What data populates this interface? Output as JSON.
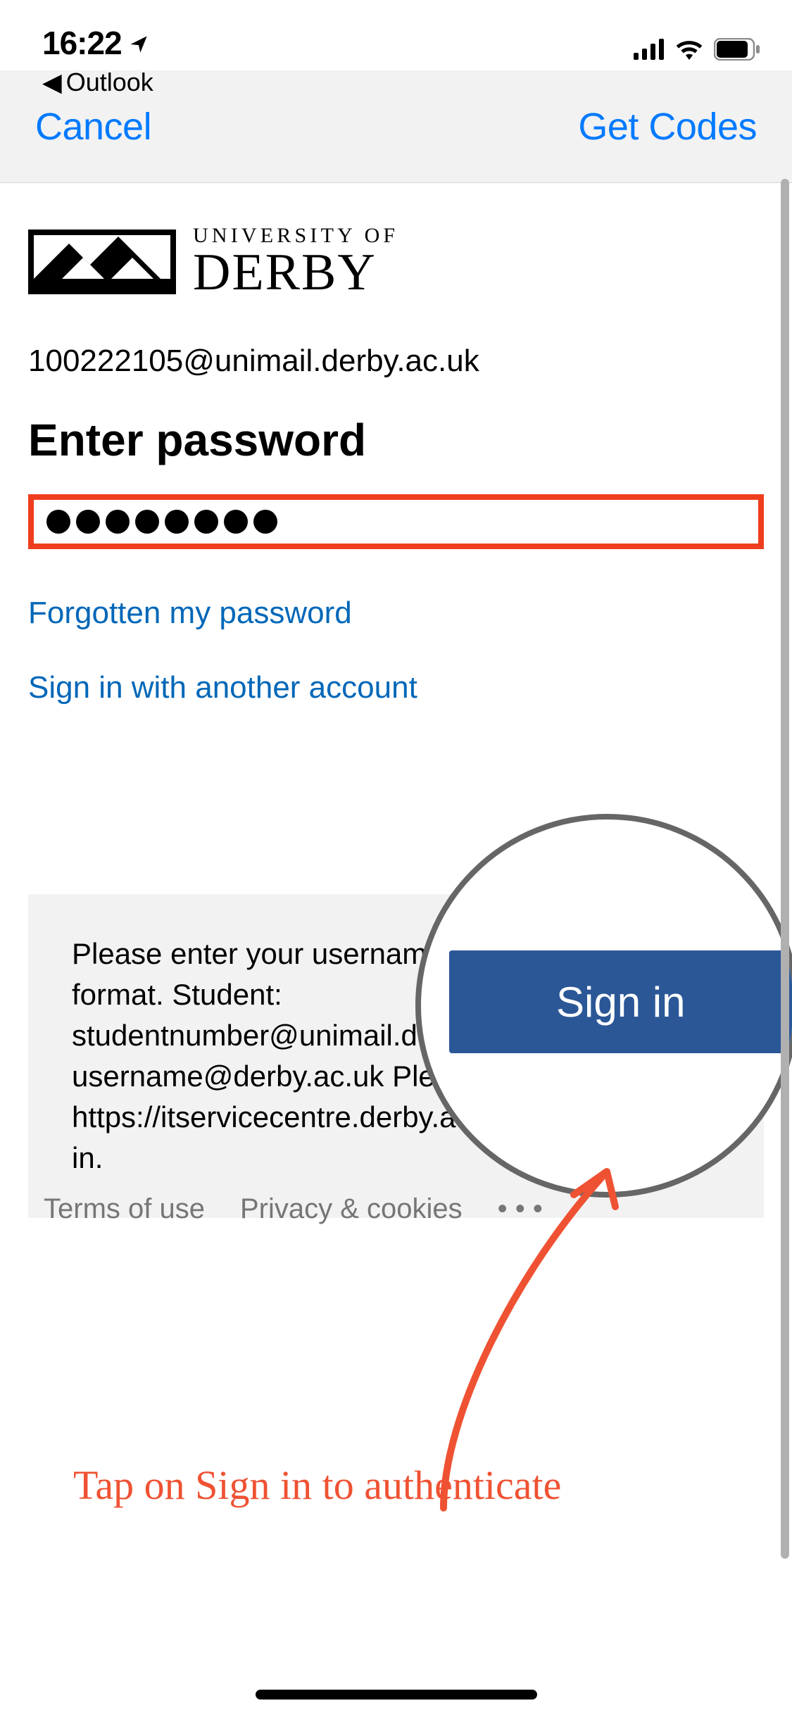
{
  "status": {
    "time": "16:22",
    "back_label": "Outlook"
  },
  "nav": {
    "cancel": "Cancel",
    "get_codes": "Get Codes"
  },
  "logo": {
    "line1": "UNIVERSITY OF",
    "line2": "DERBY"
  },
  "login": {
    "email": "100222105@unimail.derby.ac.uk",
    "heading": "Enter password",
    "password_value": "••••••••",
    "forgot_link": "Forgotten my password",
    "other_account_link": "Sign in with another account",
    "signin_button": "Sign in"
  },
  "info_text": "Please enter your username in the following format. Student: studentnumber@unimail.derby.ac.uk Staff: username@derby.ac.uk Please visit https://itservicecentre.derby.ac.uk for help signing in.",
  "annotation_text": "Tap on Sign in to authenticate",
  "footer": {
    "terms": "Terms of use",
    "privacy": "Privacy & cookies",
    "more": "• • •"
  },
  "colors": {
    "ios_blue": "#007aff",
    "ms_blue": "#2b5797",
    "link_blue": "#0067b8",
    "highlight_red": "#ef3e1f",
    "annotation_red": "#ef5233"
  }
}
